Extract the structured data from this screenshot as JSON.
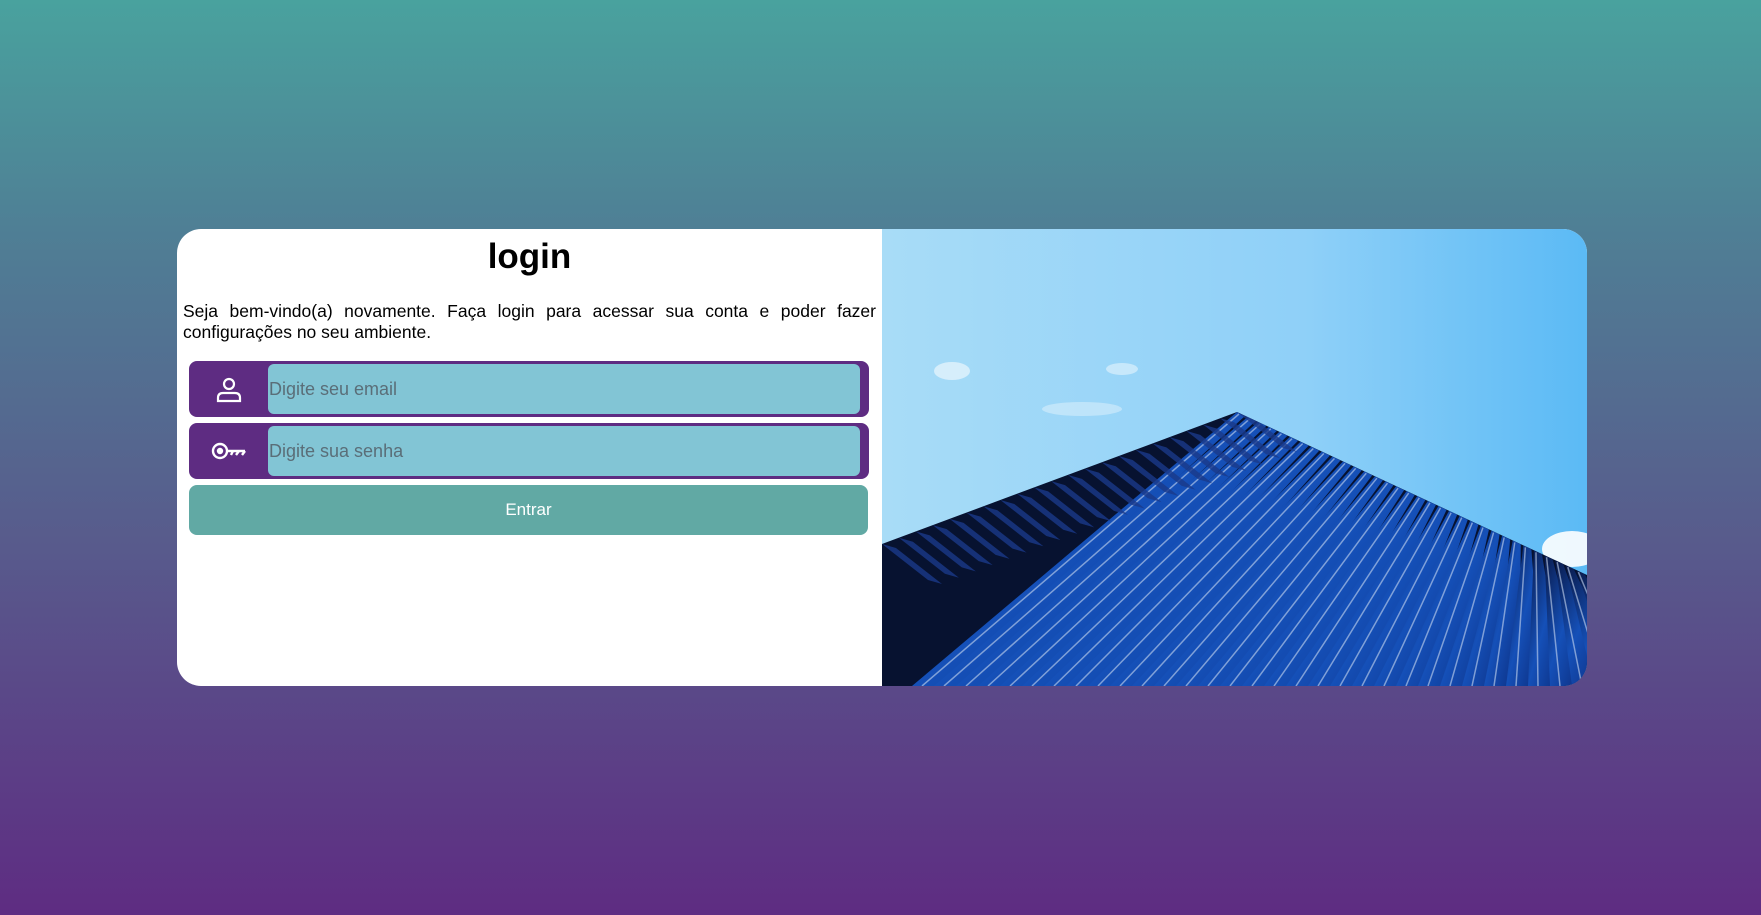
{
  "login": {
    "title": "login",
    "subtitle": "Seja bem-vindo(a) novamente. Faça login para acessar sua conta e poder fazer configurações no seu ambiente.",
    "email": {
      "placeholder": "Digite seu email",
      "value": "",
      "icon": "user-icon"
    },
    "password": {
      "placeholder": "Digite sua senha",
      "value": "",
      "icon": "key-icon"
    },
    "submit_label": "Entrar"
  },
  "colors": {
    "background_top": "#49a29e",
    "background_bottom": "#5e2c82",
    "field_frame": "#5e2c82",
    "input_fill": "#82c5d5",
    "button": "#61a9a4",
    "card": "#ffffff"
  },
  "hero_image": {
    "subject": "building-facade-against-sky"
  }
}
